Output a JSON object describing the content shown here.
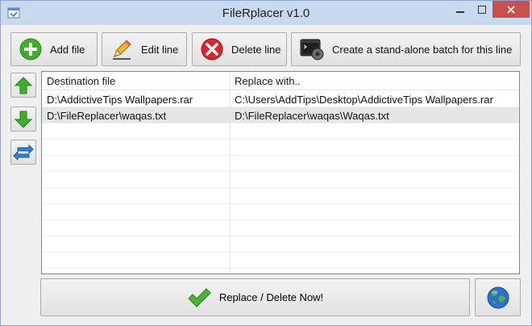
{
  "window": {
    "title": "FileRplacer v1.0"
  },
  "toolbar": {
    "add_label": "Add file",
    "edit_label": "Edit line",
    "delete_label": "Delete line",
    "batch_label": "Create a stand-alone batch for this line"
  },
  "table": {
    "columns": [
      "Destination file",
      "Replace with.."
    ],
    "rows": [
      [
        "D:\\AddictiveTips Wallpapers.rar",
        "C:\\Users\\AddTips\\Desktop\\AddictiveTips Wallpapers.rar"
      ],
      [
        "D:\\FileReplacer\\waqas.txt",
        "D:\\FileReplacer\\waqas\\Waqas.txt"
      ]
    ],
    "selected_row": 1
  },
  "actions": {
    "replace_label": "Replace / Delete Now!"
  },
  "icons": {
    "add": "plus-circle-icon",
    "edit": "pencil-icon",
    "delete": "x-circle-icon",
    "batch": "console-gear-icon",
    "up": "arrow-up-icon",
    "down": "arrow-down-icon",
    "swap": "swap-arrows-icon",
    "replace": "checkmark-icon",
    "globe": "globe-icon"
  },
  "colors": {
    "accent_green": "#3fae2a",
    "delete_red": "#d9262c",
    "swap_blue": "#2f7fd8"
  }
}
